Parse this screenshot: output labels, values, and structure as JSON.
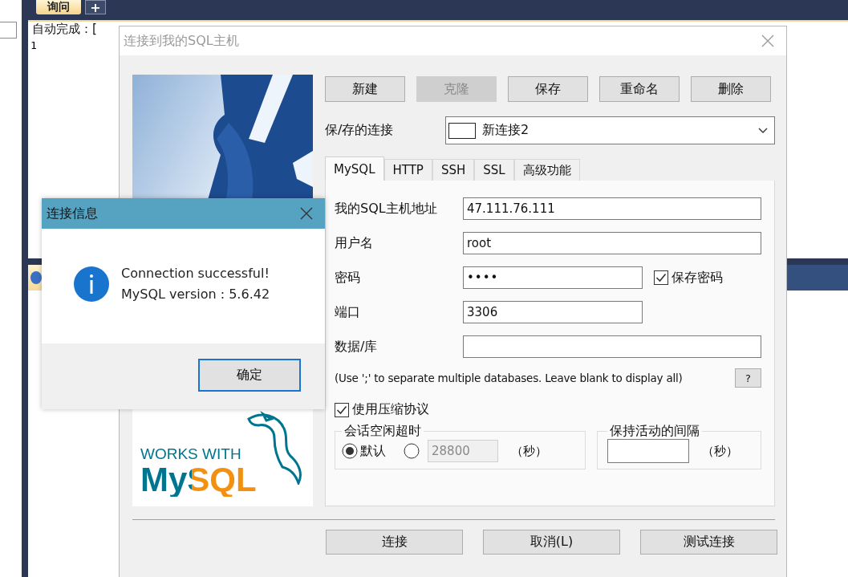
{
  "query_tab": {
    "label": "询问",
    "selected": true
  },
  "new_tab_button": "+",
  "autocomplete_hint": "自动完成：[",
  "line_numbers": [
    "1"
  ],
  "connect_dialog": {
    "title": "连接到我的SQL主机",
    "logo": {
      "caption": "WORKS WITH",
      "name": "MySQL"
    },
    "toolbar": [
      {
        "label": "新建",
        "disabled": false
      },
      {
        "label": "克隆",
        "disabled": true
      },
      {
        "label": "保存",
        "disabled": false
      },
      {
        "label": "重命名",
        "disabled": false
      },
      {
        "label": "删除",
        "disabled": false
      }
    ],
    "saved_connection": {
      "label": "保/存的连接",
      "value": "新连接2"
    },
    "tabs": [
      {
        "label": "MySQL",
        "selected": true
      },
      {
        "label": "HTTP",
        "selected": false
      },
      {
        "label": "SSH",
        "selected": false
      },
      {
        "label": "SSL",
        "selected": false
      },
      {
        "label": "高级功能",
        "selected": false
      }
    ],
    "fields": [
      {
        "kind": "text",
        "label": "我的SQL主机地址",
        "value": "47.111.76.111"
      },
      {
        "kind": "text",
        "label": "用户名",
        "value": "root"
      },
      {
        "kind": "password",
        "label": "密码",
        "value": "••••",
        "checkbox": {
          "label": "保存密码",
          "checked": true
        }
      },
      {
        "kind": "port",
        "label": "端口",
        "value": "3306"
      },
      {
        "kind": "text",
        "label": "数据/库"
      }
    ],
    "hint": "(Use ';' to separate multiple databases. Leave blank to display all)",
    "help_button": "?",
    "compression": {
      "label": "使用压缩协议",
      "checked": true
    },
    "session_timeout": {
      "title": "会话空闲超时",
      "options": [
        {
          "label": "默认",
          "selected": true
        },
        {
          "selected": false
        }
      ],
      "custom_field": {
        "value": "28800",
        "disabled": true
      },
      "unit": "（秒）"
    },
    "keepalive": {
      "title": "保持活动的间隔",
      "unit": "（秒）"
    },
    "footer_buttons": [
      "连接",
      "取消(L)",
      "测试连接"
    ]
  },
  "message_box": {
    "title": "连接信息",
    "lines": [
      "Connection successful!",
      "MySQL version : 5.6.42"
    ],
    "button": "确定"
  }
}
